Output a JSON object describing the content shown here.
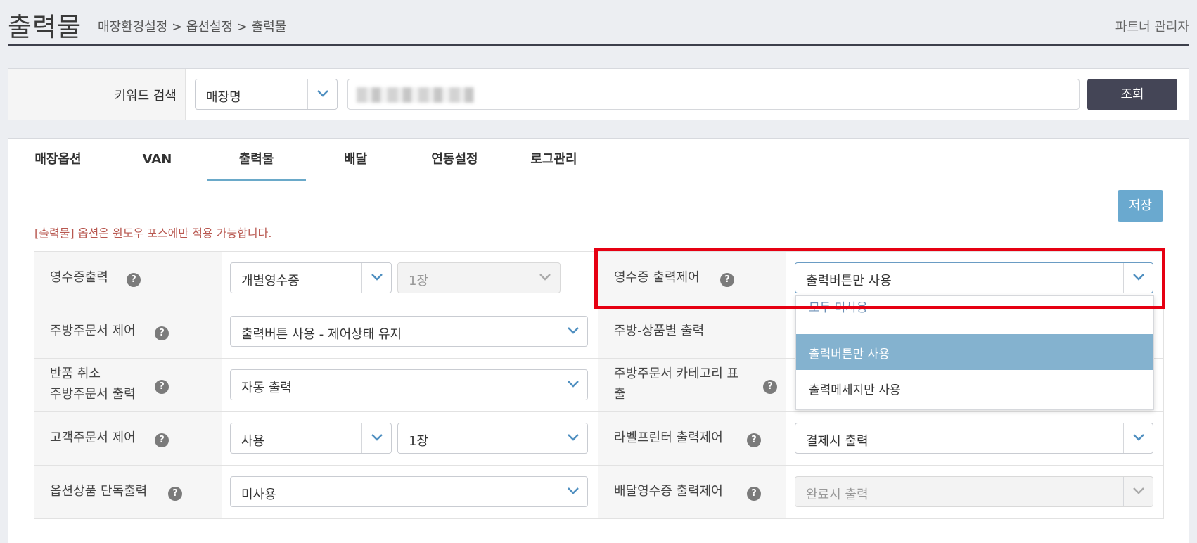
{
  "header": {
    "title": "출력물",
    "breadcrumb": "매장환경설정 > 옵션설정 > 출력물",
    "partner_label": "파트너 관리자"
  },
  "search": {
    "label": "키워드 검색",
    "field_select": "매장명",
    "button": "조회"
  },
  "tabs": [
    {
      "label": "매장옵션",
      "active": false
    },
    {
      "label": "VAN",
      "active": false
    },
    {
      "label": "출력물",
      "active": true
    },
    {
      "label": "배달",
      "active": false
    },
    {
      "label": "연동설정",
      "active": false
    },
    {
      "label": "로그관리",
      "active": false
    }
  ],
  "save_button": "저장",
  "notice": "[출력물] 옵션은 윈도우 포스에만 적용 가능합니다.",
  "options": {
    "receipt_output": {
      "label": "영수증출력",
      "value": "개별영수증",
      "copies": "1장"
    },
    "kitchen_control": {
      "label": "주방주문서 제어",
      "value": "출력버튼 사용 - 제어상태 유지"
    },
    "return_cancel": {
      "label_line1": "반품 취소",
      "label_line2": "주방주문서 출력",
      "value": "자동 출력"
    },
    "customer_order": {
      "label": "고객주문서 제어",
      "value": "사용",
      "copies": "1장"
    },
    "option_single": {
      "label": "옵션상품 단독출력",
      "value": "미사용"
    },
    "receipt_control": {
      "label": "영수증 출력제어",
      "value": "출력버튼만 사용"
    },
    "kitchen_per_item": {
      "label": "주방-상품별 출력"
    },
    "kitchen_category": {
      "label_line1": "주방주문서 카테고리 표",
      "label_line2": "출"
    },
    "label_printer": {
      "label": "라벨프린터 출력제어",
      "value": "결제시 출력"
    },
    "delivery_receipt": {
      "label": "배달영수증 출력제어",
      "value": "완료시 출력"
    }
  },
  "dropdown": {
    "items": [
      "모두 미사용",
      "출력버튼만 사용",
      "출력메세지만 사용"
    ],
    "selected_index": 1
  },
  "colors": {
    "accent": "#6aa9cf",
    "dark_button": "#444556",
    "highlight": "#e60012",
    "notice": "#b8574f"
  }
}
